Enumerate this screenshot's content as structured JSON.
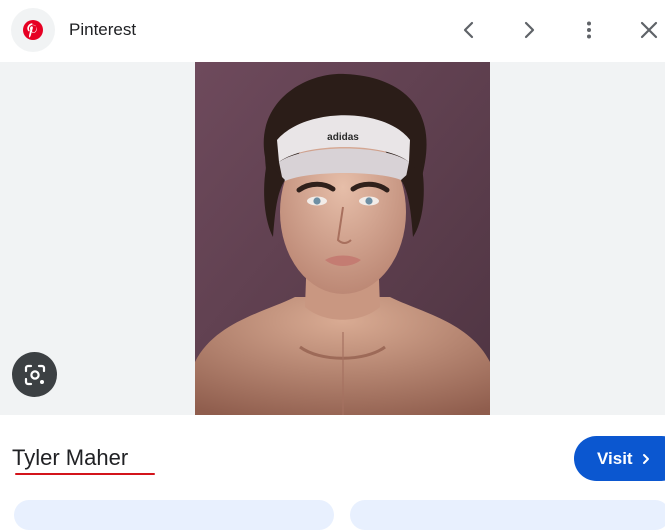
{
  "header": {
    "site_name": "Pinterest",
    "logo_icon": "pinterest-logo-icon",
    "brand_color": "#e60023",
    "actions": [
      "chevron-left-icon",
      "chevron-right-icon",
      "more-vert-icon",
      "close-icon"
    ]
  },
  "viewer": {
    "background": "#f1f3f4",
    "lens_icon": "google-lens-icon"
  },
  "result": {
    "title": "Tyler Maher",
    "visit_label": "Visit",
    "accent_color": "#0b57d0"
  }
}
